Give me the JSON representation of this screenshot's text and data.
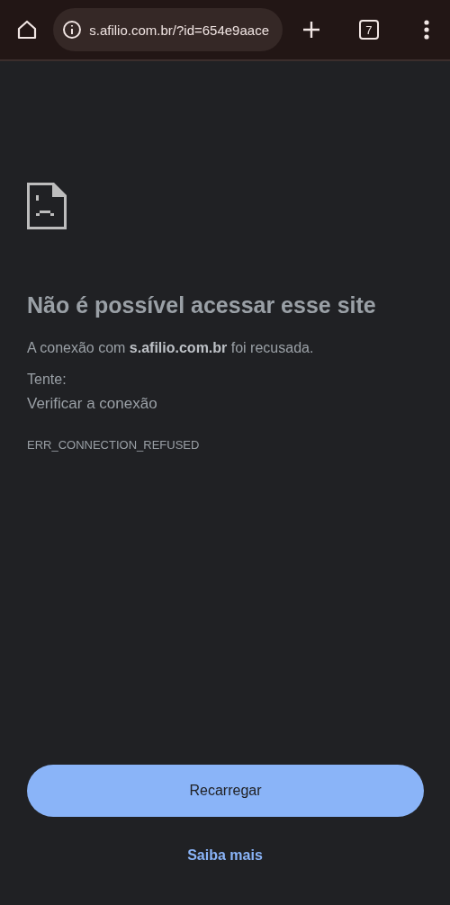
{
  "toolbar": {
    "url": "s.afilio.com.br/?id=654e9aace",
    "tab_count": "7"
  },
  "error": {
    "title": "Não é possível acessar esse site",
    "message": "A conexão com **s.afilio.com.br** foi recusada.",
    "try_label": "Tente:",
    "suggestions": [
      "Verificar a conexão"
    ],
    "code": "ERR_CONNECTION_REFUSED"
  },
  "buttons": {
    "reload": "Recarregar",
    "learn_more": "Saiba mais"
  }
}
